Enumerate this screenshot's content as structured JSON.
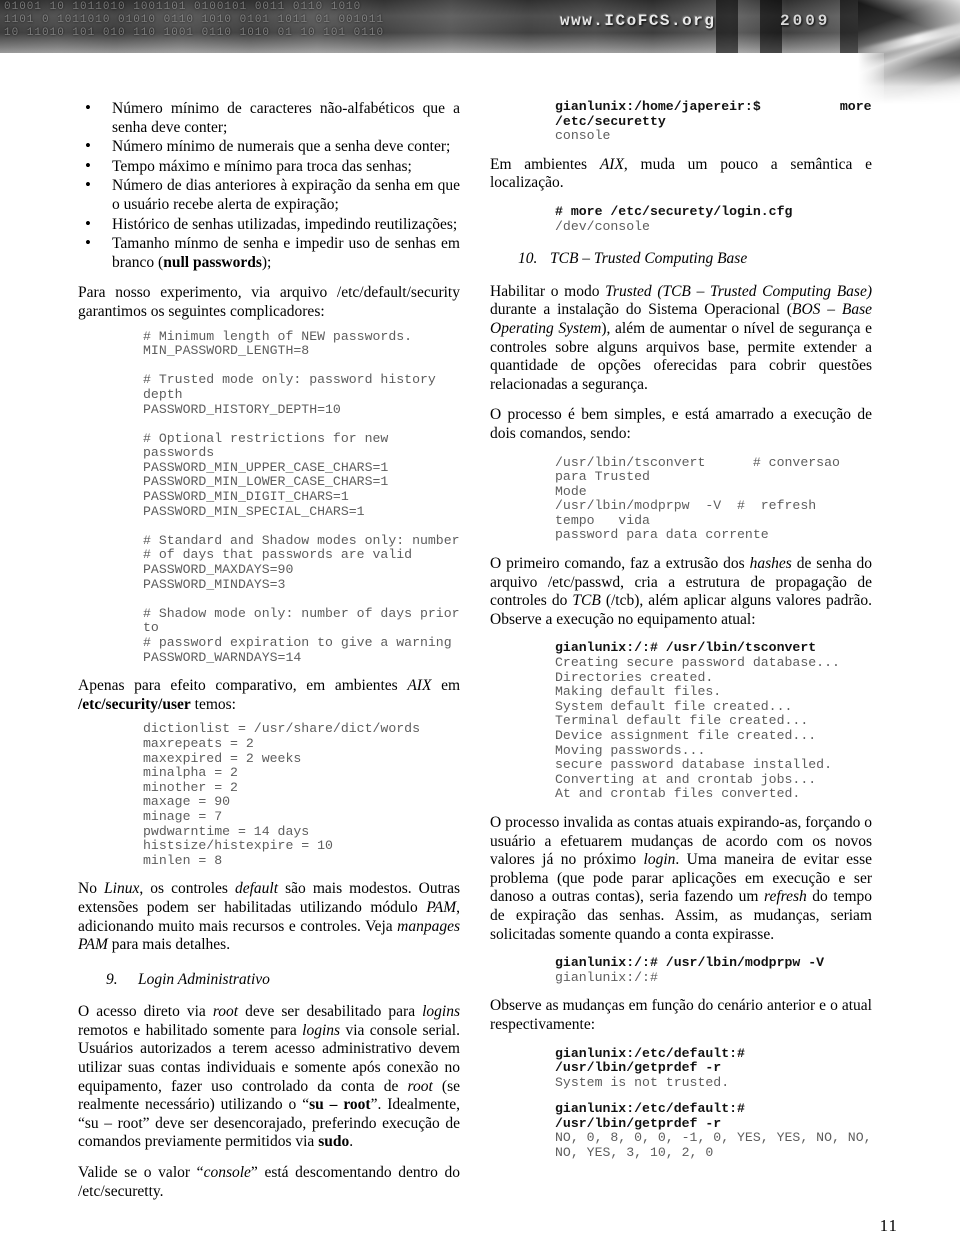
{
  "header": {
    "site_text": "www.ICoFCS.org",
    "year": "2009",
    "bits": "01001 10 1011010 1001101 0100101 0011 0110 1010\n1101 0 1011010 01010 0110 1010 0101 1011 01 001011\n10 11010 101 010 110 1001 0110 1010 01 10 101 0110"
  },
  "page_number": "11",
  "left_column": {
    "bullets": [
      "Número mínimo de caracteres não-alfabéticos que a senha deve conter;",
      "Número mínimo de numerais que a senha deve conter;",
      "Tempo máximo e mínimo para troca das senhas;",
      "Número de dias anteriores à expiração da senha em que o usuário recebe alerta de expiração;",
      "Histórico de senhas utilizadas, impedindo reutilizações;",
      "Tamanho mínmo de senha e impedir uso de senhas em branco (null passwords);"
    ],
    "bullet_6_prefix": "Tamanho mínmo de senha e impedir uso de senhas em branco (",
    "bullet_6_bold": "null passwords",
    "bullet_6_suffix": ");",
    "para_experimento": "Para nosso experimento, via arquivo /etc/default/security garantimos os seguintes complicadores:",
    "code_security": "# Minimum length of NEW passwords.\nMIN_PASSWORD_LENGTH=8\n\n# Trusted mode only: password history\ndepth\nPASSWORD_HISTORY_DEPTH=10\n\n# Optional restrictions for new passwords\nPASSWORD_MIN_UPPER_CASE_CHARS=1\nPASSWORD_MIN_LOWER_CASE_CHARS=1\nPASSWORD_MIN_DIGIT_CHARS=1\nPASSWORD_MIN_SPECIAL_CHARS=1\n\n# Standard and Shadow modes only: number\n# of days that passwords are valid\nPASSWORD_MAXDAYS=90\nPASSWORD_MINDAYS=3\n\n# Shadow mode only: number of days prior\nto\n# password expiration to give a warning\nPASSWORD_WARNDAYS=14",
    "para_aix_prefix": "Apenas para efeito comparativo, em ambientes ",
    "para_aix_italic": "AIX",
    "para_aix_mid": " em ",
    "para_aix_bold": "/etc/security/user",
    "para_aix_suffix": " temos:",
    "code_aix_user": "dictionlist = /usr/share/dict/words\nmaxrepeats = 2\nmaxexpired = 2 weeks\nminalpha = 2\nminother = 2\nmaxage = 90\nminage = 7\npwdwarntime = 14 days\nhistsize/histexpire = 10\nminlen = 8",
    "para_linux_1": "No ",
    "para_linux_i1": "Linux",
    "para_linux_2": ", os controles ",
    "para_linux_i2": "default",
    "para_linux_3": " são mais modestos. Outras extensões podem ser habilitadas utilizando módulo ",
    "para_linux_i3": "PAM",
    "para_linux_4": ", adicionando muito mais recursos e controles. Veja ",
    "para_linux_i4": "manpages PAM",
    "para_linux_5": " para mais detalhes.",
    "heading_9_num": "9.",
    "heading_9_text": "Login Administrativo",
    "para_root_1": "O acesso direto via ",
    "para_root_i1": "root",
    "para_root_2": " deve ser desabilitado para ",
    "para_root_i2": "logins",
    "para_root_3": " remotos e habilitado somente para ",
    "para_root_i3": "logins",
    "para_root_4": " via console serial. Usuários autorizados a terem acesso administrativo devem utilizar suas contas individuais e somente após conexão no equipamento, fazer uso controlado da conta de ",
    "para_root_i4": "root",
    "para_root_5": " (se realmente necessário) utilizando o “",
    "para_root_b1": "su – root",
    "para_root_6": "”. Idealmente, “su – root” deve ser desencorajado, preferindo execução de comandos previamente permitidos via ",
    "para_root_b2": "sudo",
    "para_root_7": ".",
    "para_valide_1": "Valide se o valor “",
    "para_valide_i1": "console",
    "para_valide_2": "” está descomentando dentro do /etc/securetty."
  },
  "right_column": {
    "code_securetty_cmd": "gianlunix:/home/japereir:$          more\n/etc/securetty",
    "code_securetty_out": "console",
    "para_aix_1": "Em ambientes ",
    "para_aix_i1": "AIX",
    "para_aix_2": ", muda um pouco a semântica e localização.",
    "code_logincfg_cmd": "# more /etc/securety/login.cfg",
    "code_logincfg_out": "/dev/console",
    "heading_10_num": "10.",
    "heading_10_text": "TCB – Trusted Computing Base",
    "para_tcb_1": "Habilitar o modo ",
    "para_tcb_i1": "Trusted (TCB – Trusted Computing Base)",
    "para_tcb_2": " durante a instalação do Sistema Operacional (",
    "para_tcb_i2": "BOS – Base Operating System",
    "para_tcb_3": "), além de aumentar o nível de segurança e controles sobre alguns arquivos base, permite extender a quantidade de opções oferecidas para cobrir questões relacionadas a segurança.",
    "para_processo": "O processo é bem simples, e está amarrado a execução de dois comandos, sendo:",
    "code_two_cmds": "/usr/lbin/tsconvert      # conversao para Trusted\nMode\n/usr/lbin/modprpw  -V  #  refresh   tempo   vida\npassword para data corrente",
    "para_primeiro_1": "O primeiro comando, faz a extrusão dos ",
    "para_primeiro_i1": "hashes",
    "para_primeiro_2": " de senha do arquivo /etc/passwd, cria a estrutura de propagação de controles do ",
    "para_primeiro_i2": "TCB",
    "para_primeiro_3": " (/tcb), além aplicar alguns valores padrão. Observe a execução no equipamento atual:",
    "code_tsconvert_cmd": "gianlunix:/:# /usr/lbin/tsconvert",
    "code_tsconvert_out": "Creating secure password database...\nDirectories created.\nMaking default files.\nSystem default file created...\nTerminal default file created...\nDevice assignment file created...\nMoving passwords...\nsecure password database installed.\nConverting at and crontab jobs...\nAt and crontab files converted.",
    "para_invalida_1": "O processo invalida as contas atuais expirando-as, forçando o usuário a efetuarem mudanças de acordo com os novos valores já no próximo ",
    "para_invalida_i1": "login",
    "para_invalida_2": ". Uma maneira de evitar esse problema (que pode parar aplicações em execução e ser danoso a outras contas), seria fazendo um ",
    "para_invalida_i2": "refresh",
    "para_invalida_3": " do tempo de expiração das senhas. Assim, as mudanças, seriam solicitadas somente quando a conta expirasse.",
    "code_modprpw_cmd": "gianlunix:/:# /usr/lbin/modprpw -V",
    "code_modprpw_out": "gianlunix:/:#",
    "para_observe": "Observe as mudanças em função do cenário anterior e o atual respectivamente:",
    "code_getprdef1_cmd": "gianlunix:/etc/default:#\n/usr/lbin/getprdef -r",
    "code_getprdef1_out": "System is not trusted.",
    "code_getprdef2_cmd": "gianlunix:/etc/default:#\n/usr/lbin/getprdef -r",
    "code_getprdef2_out": "NO, 0, 8, 0, 0, -1, 0, YES, YES, NO, NO,\nNO, YES, 3, 10, 2, 0"
  }
}
